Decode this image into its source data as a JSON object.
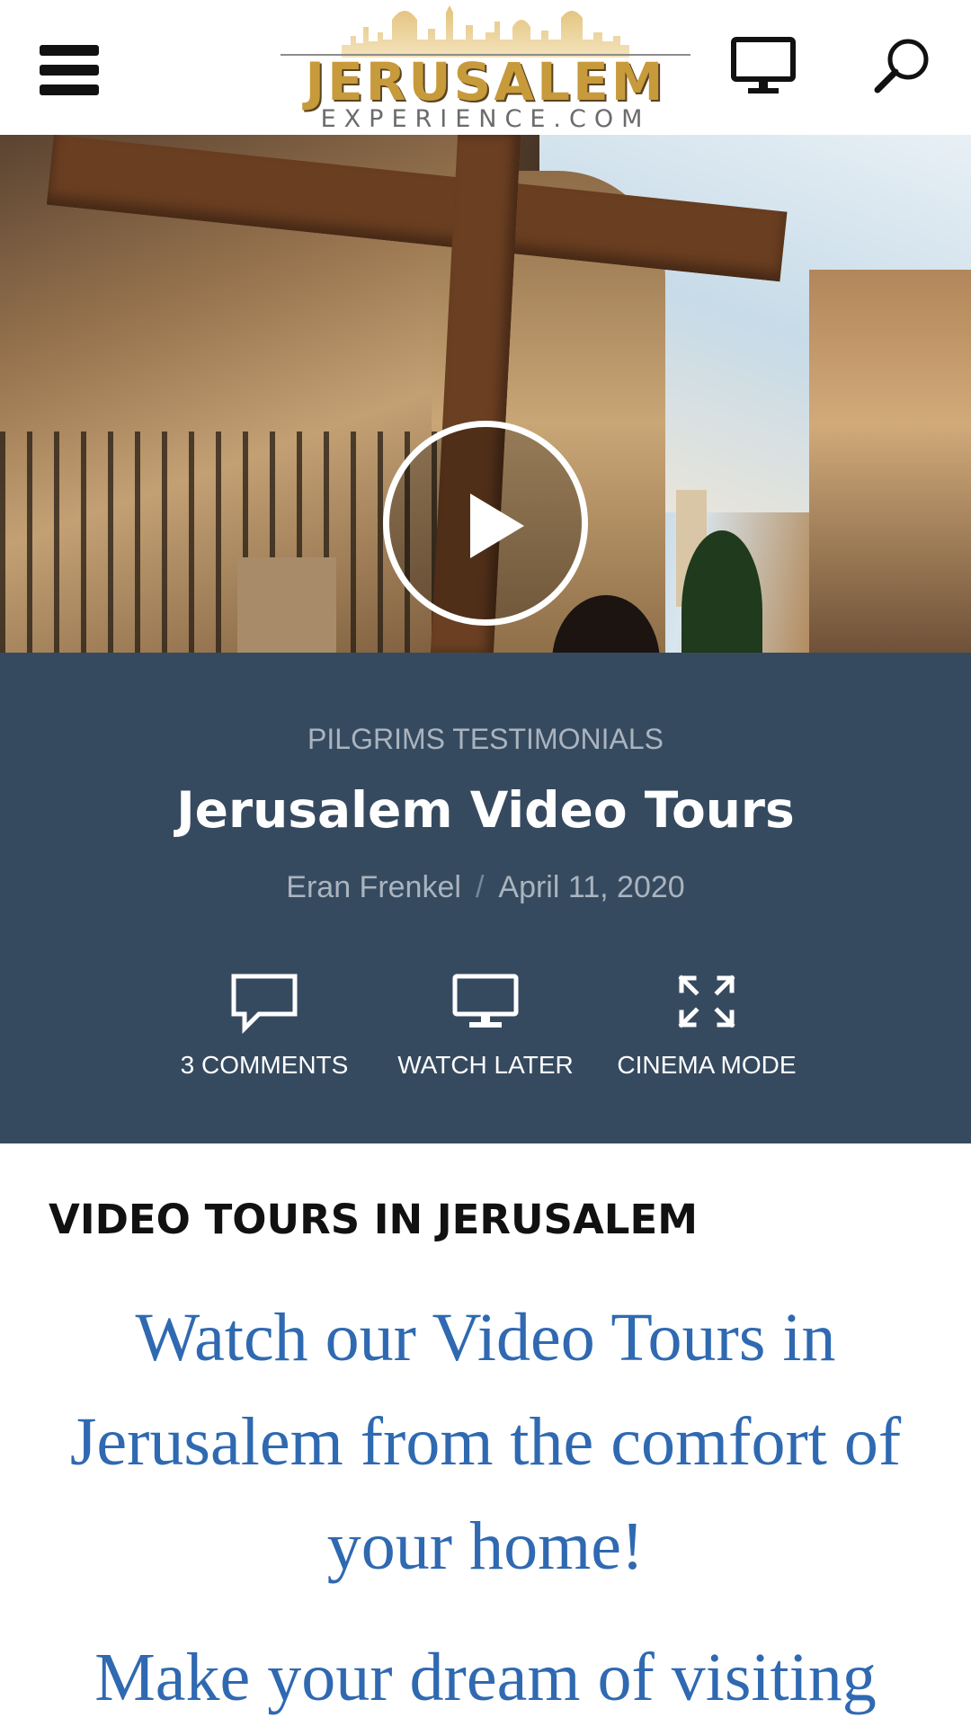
{
  "header": {
    "logo_title": "JERUSALEM",
    "logo_subtitle": "EXPERIENCE.COM",
    "icons": [
      "menu-icon",
      "monitor-icon",
      "search-icon"
    ]
  },
  "video": {
    "play_icon": "play-icon"
  },
  "post": {
    "category": "PILGRIMS TESTIMONIALS",
    "title": "Jerusalem Video Tours",
    "author": "Eran Frenkel",
    "separator": "/",
    "date": "April 11, 2020",
    "actions": [
      {
        "label": "3 COMMENTS",
        "icon": "comment-icon"
      },
      {
        "label": "WATCH LATER",
        "icon": "monitor-icon"
      },
      {
        "label": "CINEMA MODE",
        "icon": "expand-icon"
      }
    ]
  },
  "article": {
    "heading": "VIDEO TOURS IN JERUSALEM",
    "lead": "Watch our Video Tours in Jerusalem from the comfort of your home!",
    "lead2": "Make your dream of visiting"
  },
  "colors": {
    "panel": "#364a5f",
    "accent_gold": "#c79a3b",
    "link_blue": "#2f69b1"
  }
}
